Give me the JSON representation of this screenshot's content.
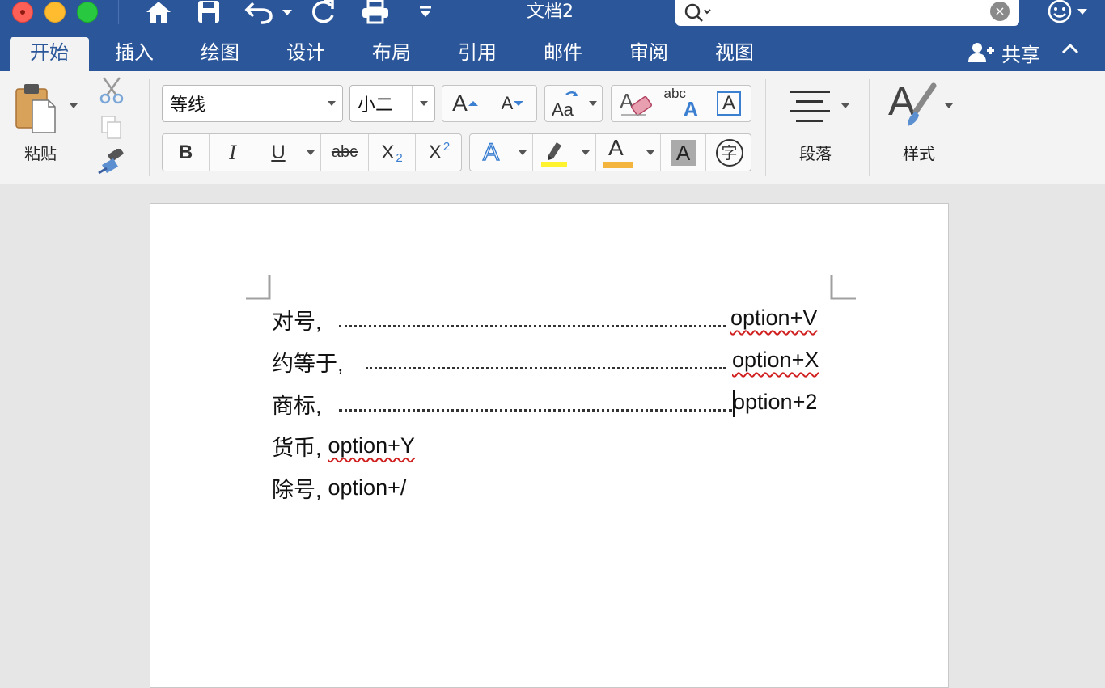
{
  "window": {
    "title": "文档2",
    "search": {
      "value": "",
      "placeholder": ""
    }
  },
  "tabs": [
    {
      "label": "开始",
      "active": true
    },
    {
      "label": "插入"
    },
    {
      "label": "绘图"
    },
    {
      "label": "设计"
    },
    {
      "label": "布局"
    },
    {
      "label": "引用"
    },
    {
      "label": "邮件"
    },
    {
      "label": "审阅"
    },
    {
      "label": "视图"
    }
  ],
  "share": {
    "label": "共享"
  },
  "ribbon": {
    "paste_label": "粘贴",
    "font_name": "等线",
    "font_size": "小二",
    "paragraph_label": "段落",
    "styles_label": "样式",
    "bold": "B",
    "italic": "I",
    "underline": "U",
    "strike": "abc",
    "subscript_base": "X",
    "subscript_mark": "2",
    "superscript_base": "X",
    "superscript_mark": "2",
    "grow": "A",
    "shrink": "A",
    "case": "Aa",
    "spell_top": "abc",
    "spell_bottom": "A",
    "textbox": "A",
    "effects": "A",
    "font_color": "A",
    "shading": "A",
    "enclose": "字",
    "highlight_color": "#fff22e",
    "font_color_bar": "#f4b53f"
  },
  "document": {
    "lines": [
      {
        "label": "对号,",
        "shortcut": "option+V",
        "leader": true,
        "spell_error": true
      },
      {
        "label": "约等于,",
        "shortcut": "option+X",
        "leader": true,
        "spell_error": true
      },
      {
        "label": "商标,",
        "shortcut": "option+2",
        "leader": true,
        "spell_error": false,
        "caret": true
      },
      {
        "label": "货币,",
        "shortcut": "option+Y",
        "leader": false,
        "spell_error": true
      },
      {
        "label": "除号,",
        "shortcut": "option+/",
        "leader": false,
        "spell_error": false
      }
    ]
  }
}
